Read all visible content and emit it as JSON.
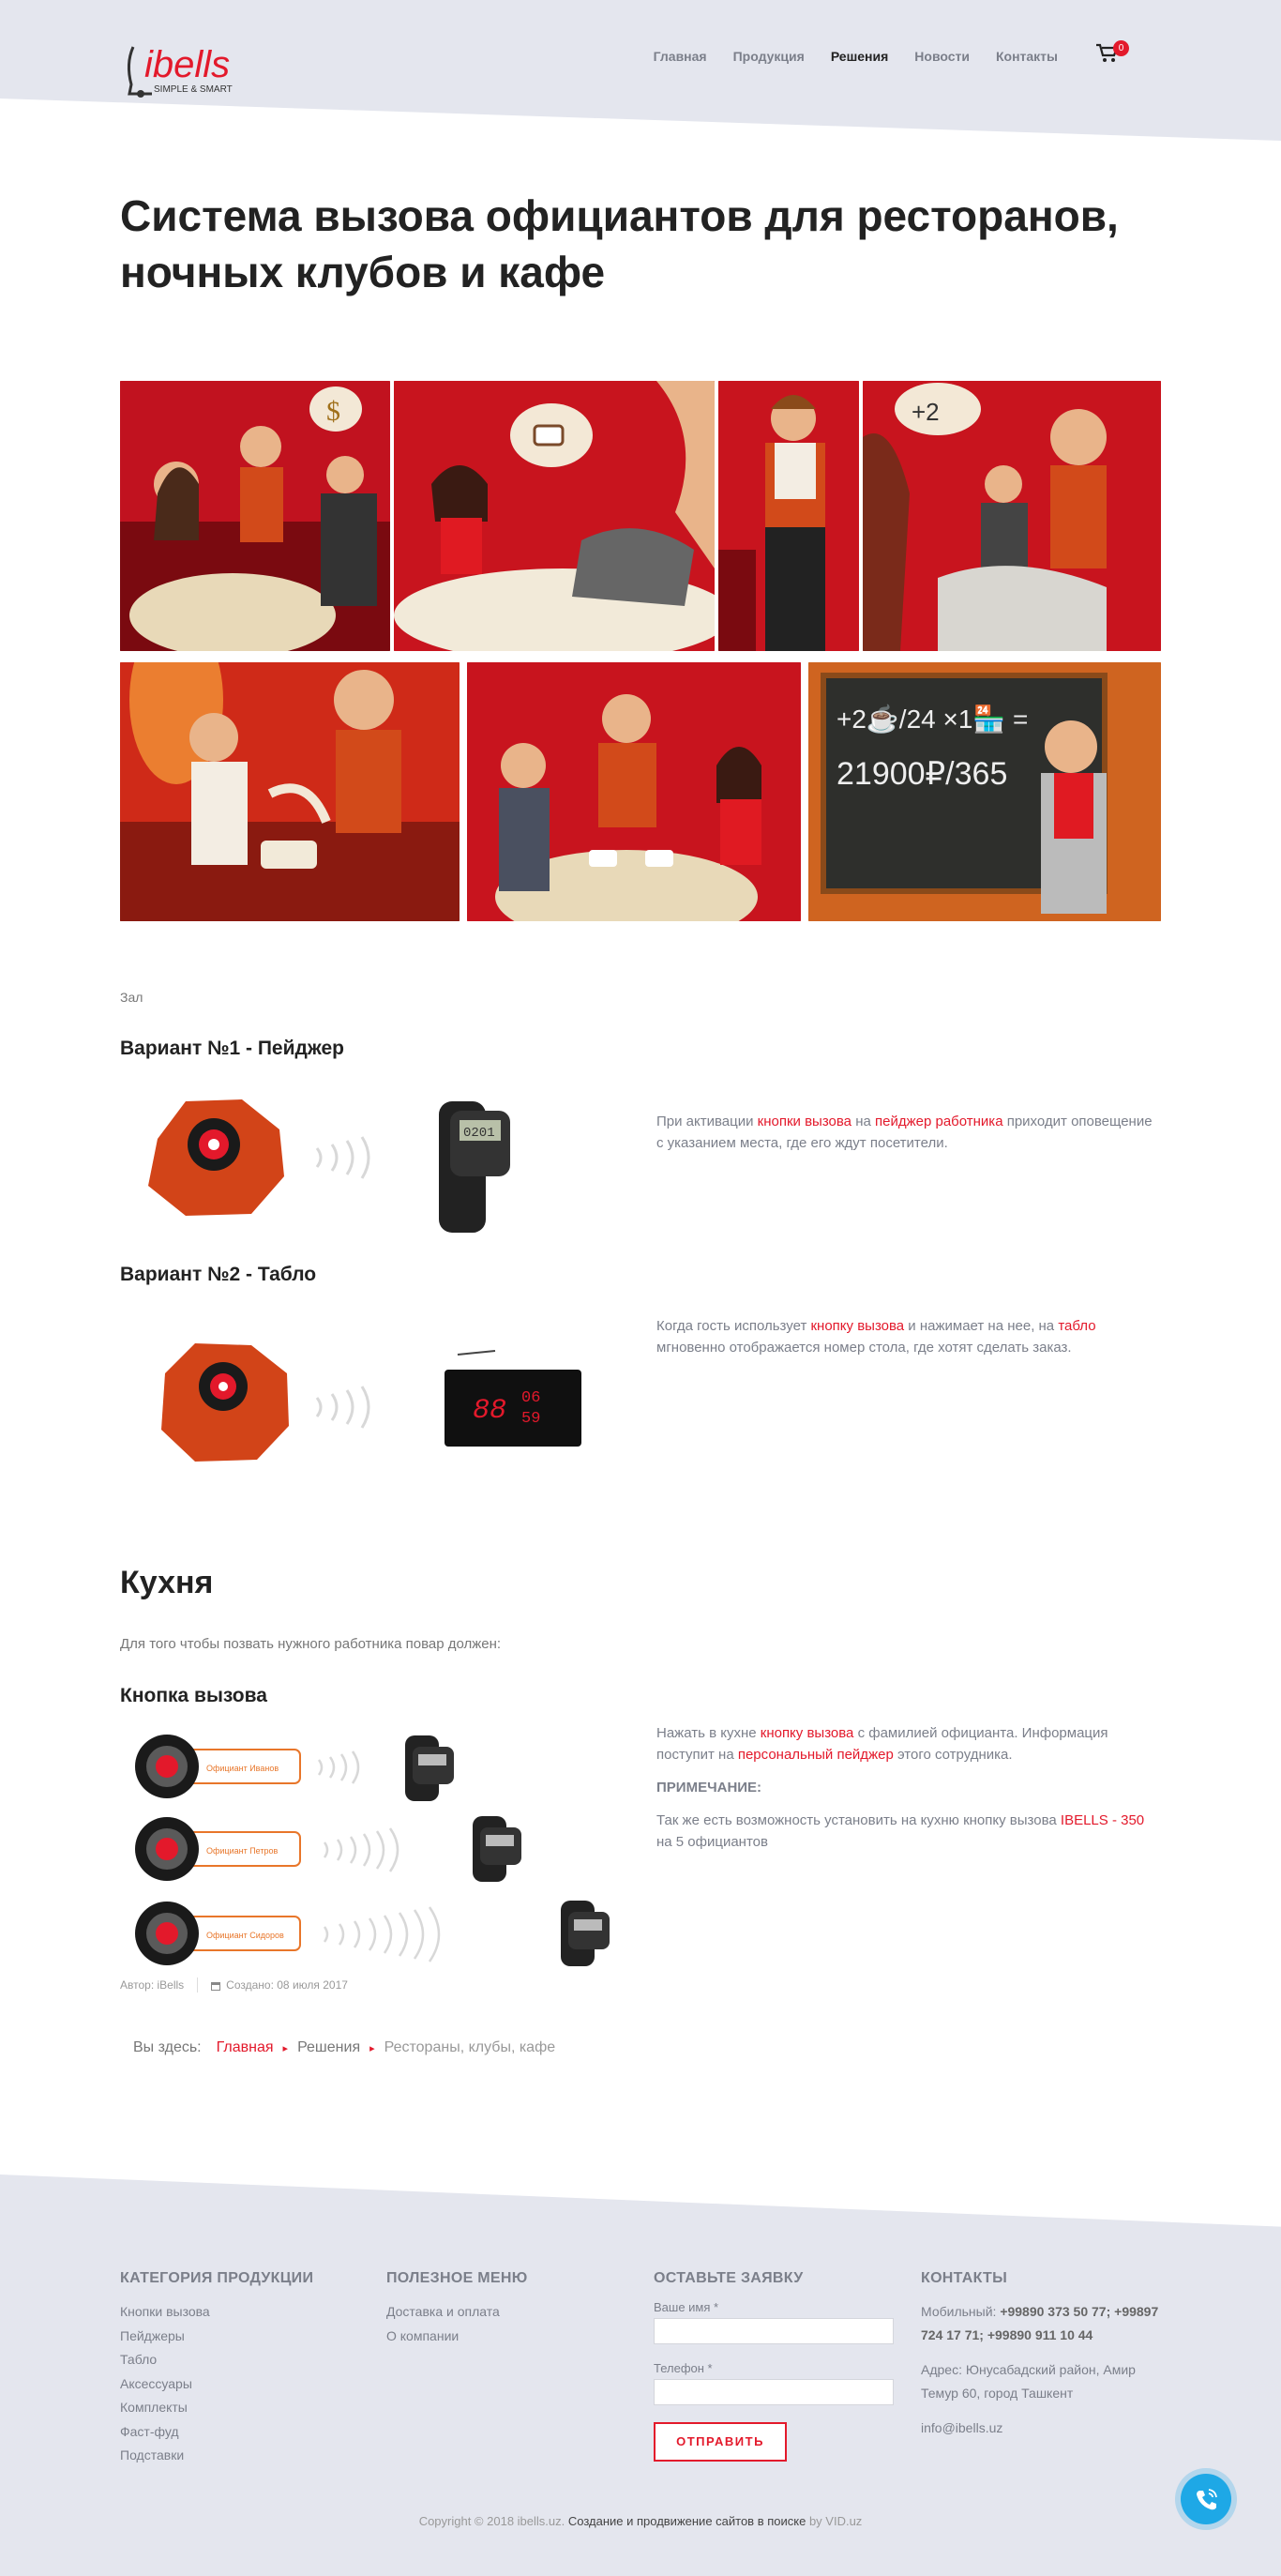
{
  "header": {
    "logo_text": "ibells",
    "logo_tagline": "SIMPLE & SMART",
    "nav": [
      {
        "label": "Главная",
        "active": false
      },
      {
        "label": "Продукция",
        "active": false
      },
      {
        "label": "Решения",
        "active": true
      },
      {
        "label": "Новости",
        "active": false
      },
      {
        "label": "Контакты",
        "active": false
      }
    ],
    "cart_count": "0",
    "cart_icon": "shopping-cart-icon"
  },
  "page": {
    "title": "Система вызова официантов для ресторанов, ночных клубов и кафе"
  },
  "gallery": {
    "photos": [
      {
        "icon": "illustration-couple-waiter-dollar"
      },
      {
        "icon": "illustration-woman-coffee-thought"
      },
      {
        "icon": "illustration-waiter-serving"
      },
      {
        "icon": "illustration-waiter-plus2-coffee"
      },
      {
        "icon": "illustration-waiter-pouring"
      },
      {
        "icon": "illustration-couple-coffee"
      },
      {
        "icon": "illustration-chalkboard-price"
      }
    ],
    "chalk_line1": "+2☕/24 ×1🏪 =",
    "chalk_line2": "21900₽/365"
  },
  "hall": {
    "label": "Зал",
    "variant1": {
      "heading": "Вариант №1 - Пейджер",
      "display_text": "0201",
      "text_parts": [
        "При активации ",
        "кнопки вызова",
        " на ",
        "пейджер работника",
        " приходит оповещение с указанием места, где его ждут посетители."
      ]
    },
    "variant2": {
      "heading": "Вариант №2 - Табло",
      "display_big": "88",
      "display_small_top": "06",
      "display_small_bottom": "59",
      "text_parts": [
        "Когда гость использует ",
        "кнопку вызова",
        " и нажимает на нее, на ",
        "табло",
        " мгновенно отображается номер стола, где хотят сделать заказ."
      ]
    }
  },
  "kitchen": {
    "heading": "Кухня",
    "intro": "Для того чтобы позвать нужного работника повар должен:",
    "subheading": "Кнопка вызова",
    "buttons": [
      "Официант Иванов",
      "Официант Петров",
      "Официант Сидоров"
    ],
    "text_parts": [
      "Нажать в кухне ",
      "кнопку вызова",
      " с фамилией официанта. Информация поступит на ",
      "персональный пейджер",
      " этого сотрудника."
    ],
    "note_label": "ПРИМЕЧАНИЕ:",
    "note_parts": [
      "Так же есть возможность установить на кухню кнопку вызова ",
      "IBELLS - 350",
      " на 5 официантов"
    ]
  },
  "meta": {
    "author": "Автор: iBells",
    "created": "Создано: 08 июля 2017",
    "calendar_icon": "calendar-icon"
  },
  "breadcrumb": {
    "prefix": "Вы здесь:",
    "items": [
      "Главная",
      "Решения",
      "Рестораны, клубы, кафе"
    ]
  },
  "footer": {
    "categories": {
      "title": "КАТЕГОРИЯ ПРОДУКЦИИ",
      "items": [
        "Кнопки вызова",
        "Пейджеры",
        "Табло",
        "Аксессуары",
        "Комплекты",
        "Фаст-фуд",
        "Подставки"
      ]
    },
    "useful": {
      "title": "ПОЛЕЗНОЕ МЕНЮ",
      "items": [
        "Доставка и оплата",
        "О компании"
      ]
    },
    "form": {
      "title": "ОСТАВЬТЕ ЗАЯВКУ",
      "name_label": "Ваше имя *",
      "phone_label": "Телефон *",
      "name_value": "",
      "phone_value": "",
      "submit": "ОТПРАВИТЬ"
    },
    "contacts": {
      "title": "КОНТАКТЫ",
      "mobile_label": "Мобильный:",
      "mobile_value": "+99890 373 50 77; +99897 724 17 71; +99890 911 10 44",
      "address": "Адрес: Юнусабадский район, Амир Темур 60, город Ташкент",
      "email": "info@ibells.uz"
    },
    "copyright_parts": [
      "Copyright © 2018 ibells.uz. ",
      "Создание и продвижение сайтов в поиске",
      " by VID.uz"
    ]
  },
  "colors": {
    "accent": "#e3192b",
    "header_bg": "#e4e6ee",
    "text": "#7b7f8a",
    "call_button": "#1ea8e6"
  },
  "call_button_icon": "phone-call-icon"
}
